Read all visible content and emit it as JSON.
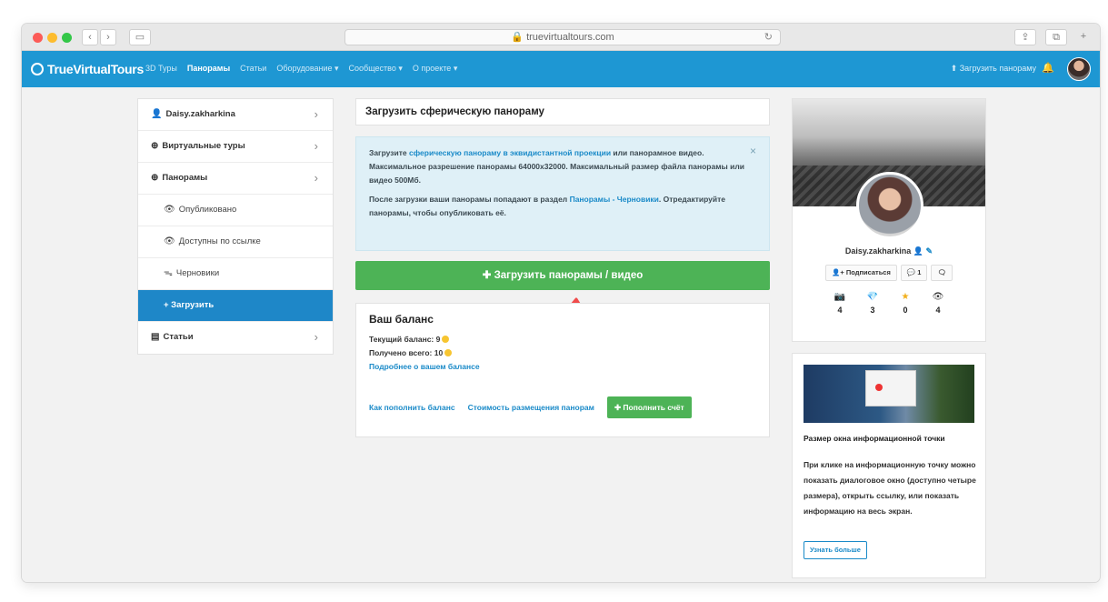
{
  "browser": {
    "url": "truevirtualtours.com",
    "back_glyph": "‹",
    "forward_glyph": "›",
    "sidebar_glyph": "▭",
    "share_glyph": "⇪",
    "tabs_glyph": "⧉",
    "newtab_glyph": "+",
    "reload_glyph": "↻"
  },
  "site": {
    "logo": "TrueVirtualTours",
    "menu": [
      "3D Туры",
      "Панорамы",
      "Статьи",
      "Оборудование ▾",
      "Сообщество ▾",
      "О проекте ▾"
    ],
    "upload_link": "⬆ Загрузить панораму",
    "bell": "🔔"
  },
  "sidebar": {
    "items": [
      {
        "label": "Daisy.zakharkina",
        "icon": "👤",
        "chevron": "›"
      },
      {
        "label": "Виртуальные туры",
        "icon": "⊕",
        "chevron": "›"
      },
      {
        "label": "Панорамы",
        "icon": "⊕",
        "chevron": "›"
      },
      {
        "label": "Опубликовано",
        "icon": "👁"
      },
      {
        "label": "Доступны по ссылке",
        "icon": "👁"
      },
      {
        "label": "Черновики",
        "icon": "ᯓ"
      },
      {
        "label": "+ Загрузить"
      },
      {
        "label": "Статьи",
        "icon": "▤",
        "chevron": "›"
      }
    ]
  },
  "main": {
    "title": "Загрузить сферическую панораму",
    "info": {
      "p1_pre": "Загрузите ",
      "p1_link": "сферическую панораму в эквидистантной проекции",
      "p1_post": " или панорамное видео. Максимальное разрешение панорамы 64000x32000. Максимальный размер файла панорамы или видео 500Мб.",
      "p2_pre": "После загрузки ваши панорамы попадают в раздел ",
      "p2_link": "Панорамы - Черновики",
      "p2_post": ". Отредактируйте панорамы, чтобы опубликовать её.",
      "close": "×"
    },
    "upload_button": "✚ Загрузить панорамы / видео",
    "balance": {
      "title": "Ваш баланс",
      "current": "Текущий баланс: 9",
      "received": "Получено всего: 10",
      "more": "Подробнее о вашем балансе",
      "how_link": "Как пополнить баланс",
      "cost_link": "Стоимость размещения панорам",
      "topup": "✚ Пополнить счёт"
    }
  },
  "profile": {
    "name": "Daisy.zakharkina",
    "badges": "👤 ✎",
    "subscribe": "👤+ Подписаться",
    "comments": "💬 1",
    "chat": "🗨",
    "stats": [
      {
        "icon": "📷",
        "value": "4",
        "color": "#333333"
      },
      {
        "icon": "💎",
        "value": "3",
        "color": "#2ea7e0"
      },
      {
        "icon": "★",
        "value": "0",
        "color": "#f2b01e"
      },
      {
        "icon": "👁",
        "value": "4",
        "color": "#333333"
      }
    ]
  },
  "promo": {
    "title": "Размер окна информационной точки",
    "text": "При клике на информационную точку можно показать диалоговое окно (доступно четыре размера), открыть ссылку, или показать информацию на весь экран.",
    "button": "Узнать больше"
  },
  "colors": {
    "nav": "#1e97d3",
    "green": "#4db356",
    "active": "#1e87c8",
    "arrow": "#f04b4b"
  }
}
